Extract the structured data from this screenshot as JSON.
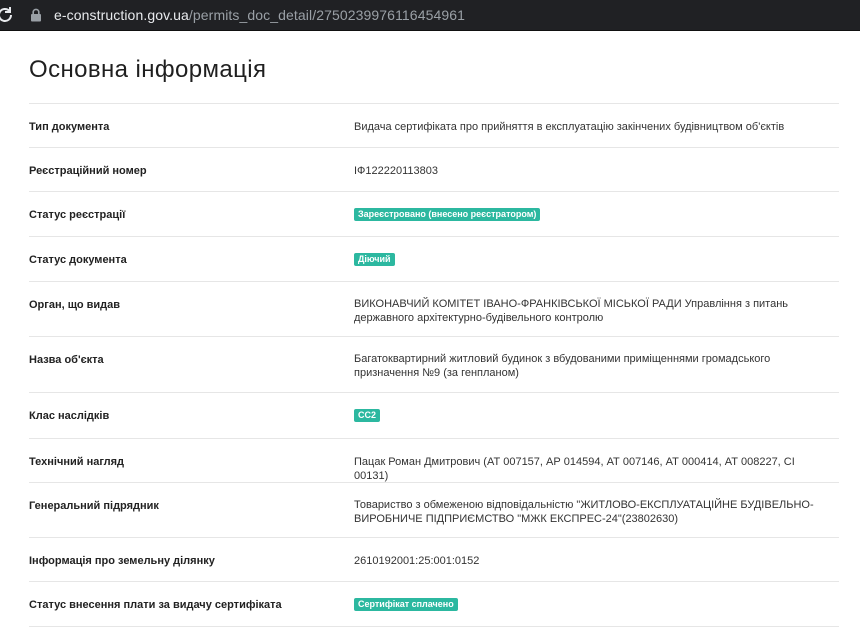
{
  "browser": {
    "url_host": "e-construction.gov.ua",
    "url_path": "/permits_doc_detail/2750239976116454961",
    "reload_icon": "reload-icon",
    "lock_icon": "lock-icon"
  },
  "page": {
    "title": "Основна інформація"
  },
  "colors": {
    "badge": "#2cb8a0",
    "browser_bar": "#202124"
  },
  "rows": [
    {
      "label": "Тип документа",
      "value": "Видача сертифіката про прийняття в експлуатацію закінчених будівництвом об'єктів",
      "type": "text"
    },
    {
      "label": "Реєстраційний номер",
      "value": "ІФ122220113803",
      "type": "text"
    },
    {
      "label": "Статус реєстрації",
      "value": "Зареєстровано (внесено реєстратором)",
      "type": "badge"
    },
    {
      "label": "Статус документа",
      "value": "Діючий",
      "type": "badge"
    },
    {
      "label": "Орган, що видав",
      "value": "ВИКОНАВЧИЙ КОМІТЕТ ІВАНО-ФРАНКІВСЬКОЇ МІСЬКОЇ РАДИ Управління з питань державного архітектурно-будівельного контролю",
      "type": "text"
    },
    {
      "label": "Назва об'єкта",
      "value": "Багатоквартирний житловий будинок з вбудованими приміщеннями громадського призначення №9 (за генпланом)",
      "type": "text"
    },
    {
      "label": "Клас наслідків",
      "value": "СС2",
      "type": "badge"
    },
    {
      "label": "Технічний нагляд",
      "value": "Пацак Роман Дмитрович (АТ 007157, АР 014594, АТ 007146, АТ 000414, АТ 008227, СІ 00131)",
      "type": "text"
    },
    {
      "label": "Генеральний підрядник",
      "value": "Товариство з обмеженою відповідальністю \"ЖИТЛОВО-ЕКСПЛУАТАЦІЙНЕ БУДІВЕЛЬНО-ВИРОБНИЧЕ ПІДПРИЄМСТВО \"МЖК ЕКСПРЕС-24\"(23802630)",
      "type": "text"
    },
    {
      "label": "Інформація про земельну ділянку",
      "value": "2610192001:25:001:0152",
      "type": "text"
    },
    {
      "label": "Статус внесення плати за видачу сертифіката",
      "value": "Сертифікат сплачено",
      "type": "badge"
    }
  ]
}
